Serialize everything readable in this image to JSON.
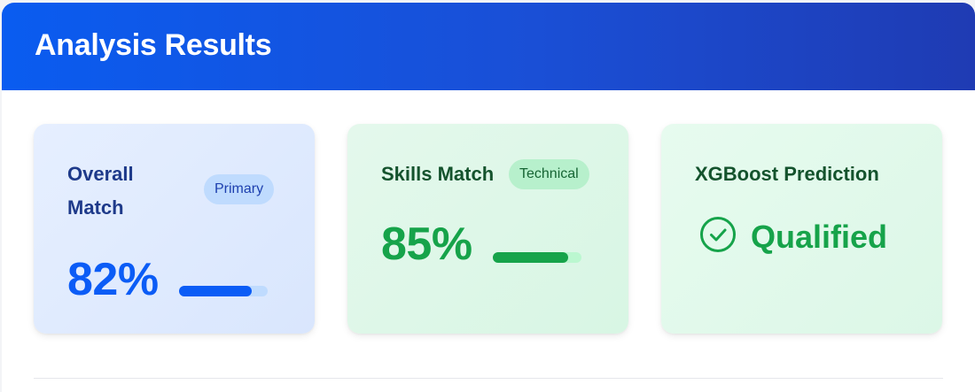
{
  "header": {
    "title": "Analysis Results"
  },
  "cards": {
    "overall": {
      "title": "Overall Match",
      "badge": "Primary",
      "value": "82%",
      "progress": 82
    },
    "skills": {
      "title": "Skills Match",
      "badge": "Technical",
      "value": "85%",
      "progress": 85
    },
    "prediction": {
      "title": "XGBoost Prediction",
      "status": "Qualified",
      "icon": "check-circle-icon"
    }
  },
  "colors": {
    "header_start": "#0a5cf0",
    "header_end": "#1f3bb3",
    "primary_blue": "#0b5cf6",
    "success_green": "#16a34a"
  }
}
